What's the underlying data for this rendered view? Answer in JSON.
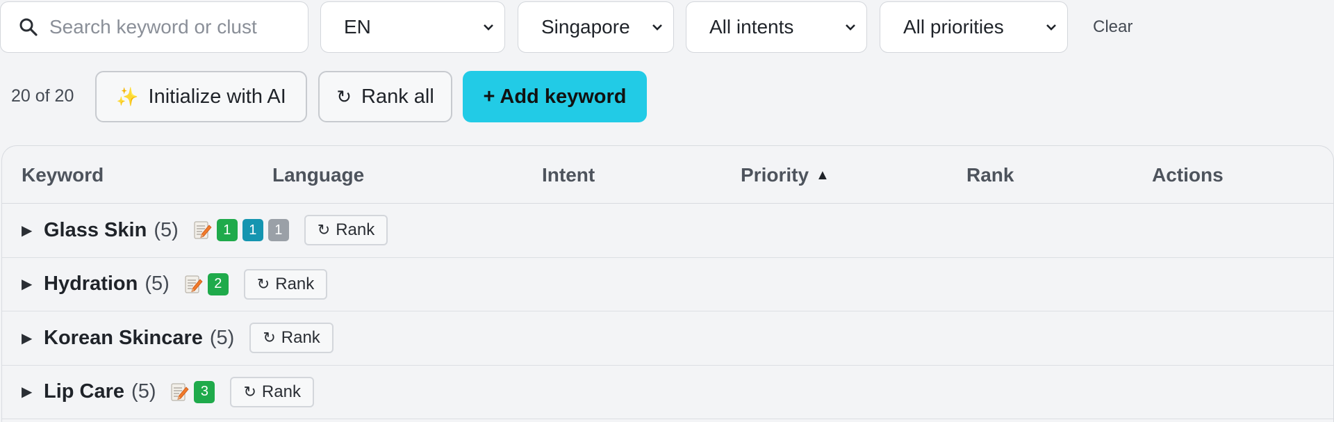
{
  "filters": {
    "search_placeholder": "Search keyword or clust",
    "language": "EN",
    "location": "Singapore",
    "intent": "All intents",
    "priority": "All priorities",
    "clear_label": "Clear"
  },
  "toolbar": {
    "count": "20 of 20",
    "init_icon": "✨",
    "init_label": "Initialize with AI",
    "rank_all_icon": "↻",
    "rank_all_label": "Rank all",
    "add_label": "+ Add keyword"
  },
  "table": {
    "headers": {
      "keyword": "Keyword",
      "language": "Language",
      "intent": "Intent",
      "priority": "Priority",
      "priority_sort": "▲",
      "rank": "Rank",
      "actions": "Actions"
    },
    "rank_button_label": "Rank",
    "rank_button_icon": "↻",
    "rows": [
      {
        "name": "Glass Skin",
        "count": "(5)",
        "has_doc": true,
        "badges": [
          {
            "value": "1",
            "color": "green"
          },
          {
            "value": "1",
            "color": "teal"
          },
          {
            "value": "1",
            "color": "gray"
          }
        ]
      },
      {
        "name": "Hydration",
        "count": "(5)",
        "has_doc": true,
        "badges": [
          {
            "value": "2",
            "color": "green"
          }
        ]
      },
      {
        "name": "Korean Skincare",
        "count": "(5)",
        "has_doc": false,
        "badges": []
      },
      {
        "name": "Lip Care",
        "count": "(5)",
        "has_doc": true,
        "badges": [
          {
            "value": "3",
            "color": "green"
          }
        ]
      }
    ]
  },
  "colors": {
    "accent": "#22cbe6",
    "green": "#1faa4b",
    "teal": "#1595b0",
    "gray": "#9aa0a7"
  },
  "icons": {
    "search": "search-icon",
    "chevron": "chevron-down-icon",
    "caret": "caret-right-icon",
    "doc": "document-edit-icon"
  }
}
